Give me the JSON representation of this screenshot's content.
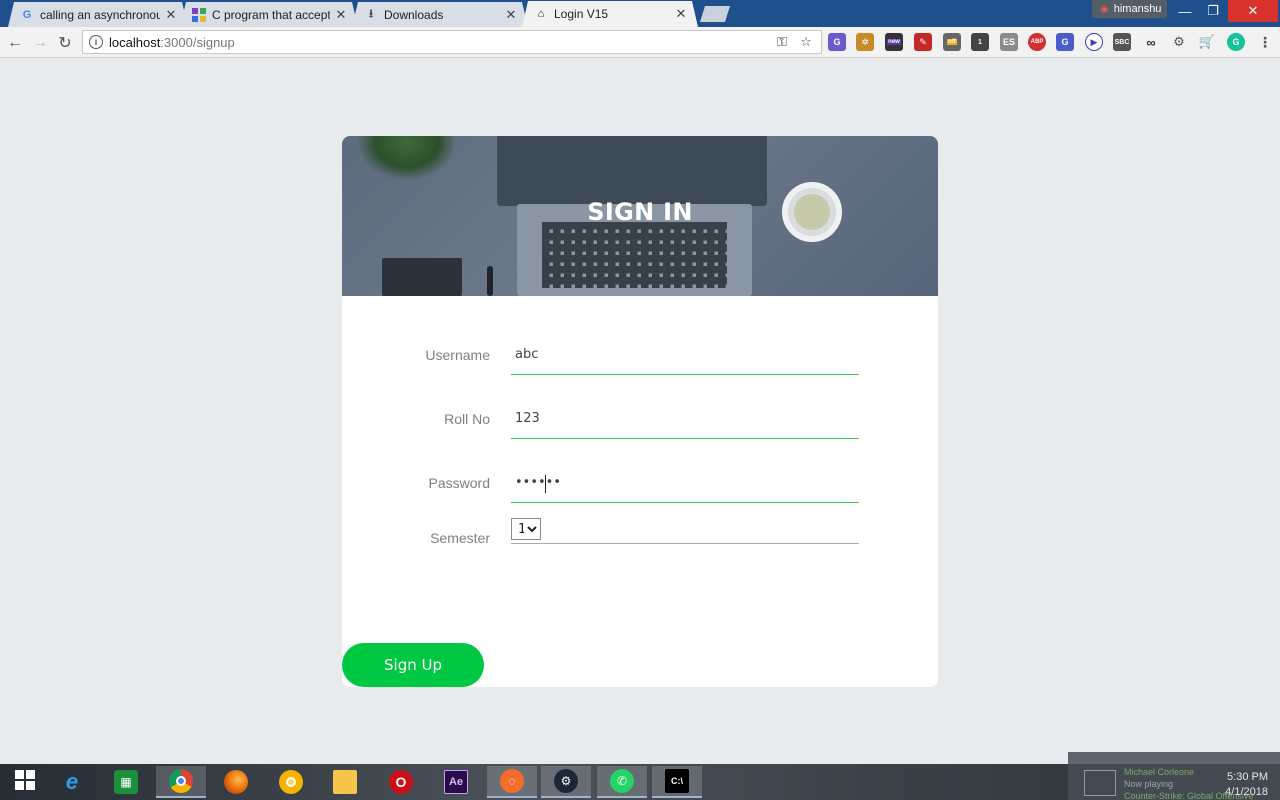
{
  "browser": {
    "tabs": [
      {
        "title": "calling an asynchronous",
        "favicon": "google-icon",
        "active": false
      },
      {
        "title": "C program that accepts",
        "favicon": "geeks-icon",
        "active": false
      },
      {
        "title": "Downloads",
        "favicon": "download-icon",
        "active": false
      },
      {
        "title": "Login V15",
        "favicon": "home-icon",
        "active": true
      }
    ],
    "profile_name": "himanshu",
    "address": {
      "host": "localhost",
      "path": ":3000/signup"
    },
    "extensions": [
      "translate-icon",
      "beetle-icon",
      "mail-icon",
      "pdf-icon",
      "badge-icon",
      "counter-icon",
      "es-icon",
      "adblock-icon",
      "translate2-icon",
      "play-icon",
      "sb-icon",
      "binoculars-icon",
      "settings-icon",
      "cart-icon",
      "grammarly-icon"
    ],
    "ext_badges": {
      "new": "new",
      "off": "off",
      "count": "1"
    },
    "ext_text": {
      "es": "ES",
      "abp": "ABP",
      "sbc": "SBC"
    }
  },
  "form": {
    "title": "SIGN IN",
    "fields": [
      {
        "label": "Username",
        "value": "abc"
      },
      {
        "label": "Roll No",
        "value": "123"
      },
      {
        "label": "Password",
        "value": "••••••"
      }
    ],
    "semester": {
      "label": "Semester",
      "selected": "1"
    },
    "submit_label": "Sign Up"
  },
  "taskbar": {
    "apps": [
      "windows-start-icon",
      "edge-icon",
      "store-icon",
      "chrome-icon",
      "firefox-icon",
      "chrome-canary-icon",
      "file-explorer-icon",
      "opera-icon",
      "after-effects-icon",
      "origin-icon",
      "steam-icon",
      "whatsapp-icon",
      "cmd-icon"
    ],
    "now_playing": {
      "artist": "Michael Corleone",
      "status": "Now playing",
      "game": "Counter-Strike: Global Offensive"
    },
    "time": "5:30 PM",
    "date": "4/1/2018"
  },
  "colors": {
    "accent_green": "#00c843",
    "underline_green": "#34c759",
    "page_bg": "#e8ebee"
  }
}
